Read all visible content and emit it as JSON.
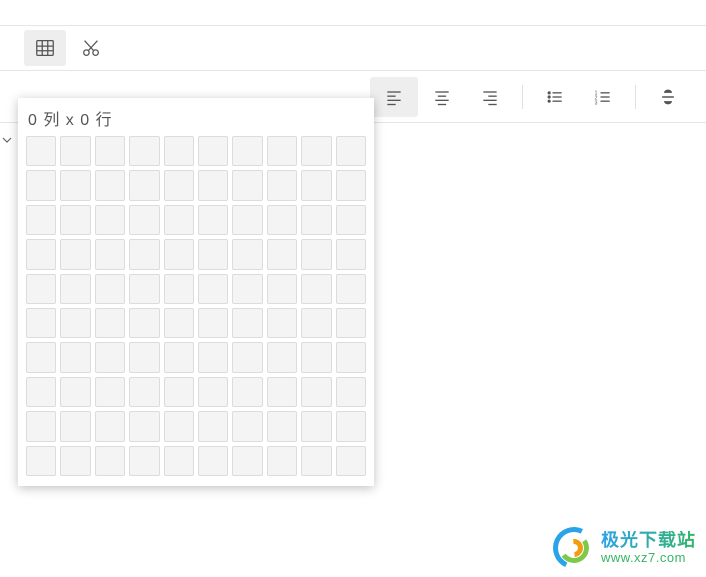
{
  "toolbar_top": {
    "table_icon": "table-icon",
    "cut_icon": "scissors-icon"
  },
  "table_picker": {
    "label": "0 列 x 0 行",
    "cols": 10,
    "rows": 10
  },
  "format_row": {
    "buttons": [
      {
        "name": "align-left-icon",
        "active": true
      },
      {
        "name": "align-center-icon",
        "active": false
      },
      {
        "name": "align-right-icon",
        "active": false
      },
      {
        "name": "sep",
        "active": false
      },
      {
        "name": "bullet-list-icon",
        "active": false
      },
      {
        "name": "number-list-icon",
        "active": false
      },
      {
        "name": "sep2",
        "active": false
      },
      {
        "name": "strikethrough-icon",
        "active": false
      }
    ]
  },
  "watermark": {
    "title": "极光下载站",
    "url": "www.xz7.com"
  }
}
